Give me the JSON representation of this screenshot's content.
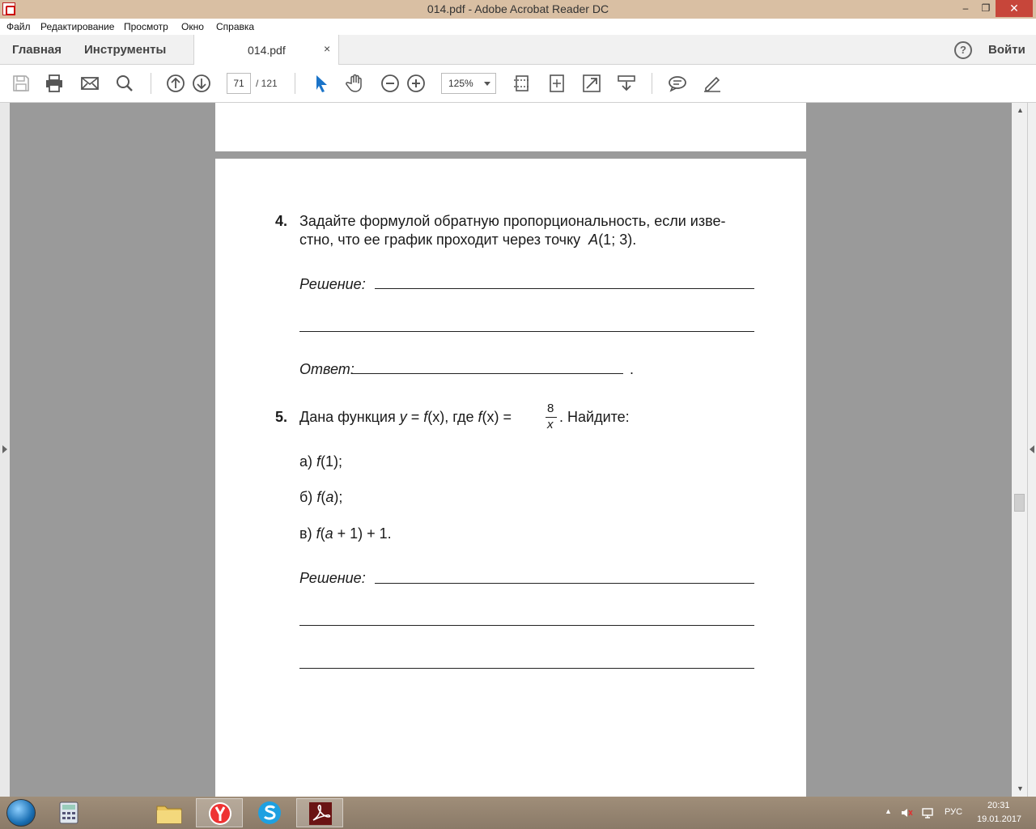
{
  "window": {
    "title": "014.pdf - Adobe Acrobat Reader DC",
    "min": "‒",
    "max": "❐",
    "close": "✕"
  },
  "menu": {
    "items": [
      "Файл",
      "Редактирование",
      "Просмотр",
      "Окно",
      "Справка"
    ]
  },
  "tabs": {
    "home": "Главная",
    "tools": "Инструменты",
    "document": "014.pdf",
    "close": "×",
    "help": "?",
    "signin": "Войти"
  },
  "toolbar": {
    "current_page": "71",
    "total_pages": "/ 121",
    "zoom": "125%",
    "icons": [
      "save-icon",
      "print-icon",
      "email-icon",
      "search-icon",
      "page-up-icon",
      "page-down-icon",
      "select-cursor-icon",
      "hand-icon",
      "zoom-out-icon",
      "zoom-in-icon",
      "fit-page-icon",
      "rotate-icon",
      "fullscreen-icon",
      "read-mode-icon",
      "comment-icon",
      "sign-icon"
    ]
  },
  "document": {
    "q4": {
      "num": "4.",
      "line1": "Задайте формулой обратную пропорциональность, если изве-",
      "line2_pre": "стно, что ее график проходит через точку",
      "point": "A",
      "coords": "(1; 3).",
      "solution_label": "Решение:",
      "answer_label": "Ответ:",
      "answer_end": "."
    },
    "q5": {
      "num": "5.",
      "text_a": "Дана функция",
      "y": "y",
      "eq1": " = ",
      "f": "f",
      "x_paren": "(x)",
      "text_b": ", где",
      "f2": "f",
      "x_paren2": "(x)",
      "eq2": " = ",
      "frac_num": "8",
      "frac_den": "x",
      "text_c": ". Найдите:",
      "item_a_label": "а)",
      "item_a_f": "f",
      "item_a_arg": "(1);",
      "item_b_label": "б)",
      "item_b_f": "f",
      "item_b_arg_open": "(",
      "item_b_var": "a",
      "item_b_arg_close": ");",
      "item_c_label": "в)",
      "item_c_f": "f",
      "item_c_open": "(",
      "item_c_var": "a",
      "item_c_rest": " + 1) + 1.",
      "solution_label": "Решение:"
    }
  },
  "taskbar": {
    "lang": "РУС",
    "time": "20:31",
    "date": "19.01.2017",
    "up_arrow": "▲"
  },
  "scroll": {
    "up": "▲",
    "down": "▼"
  }
}
